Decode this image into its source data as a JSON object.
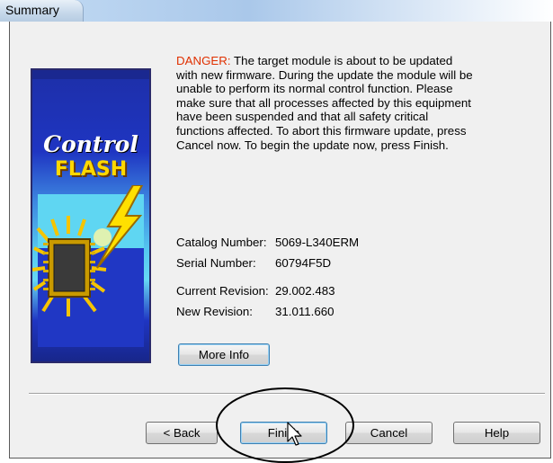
{
  "window": {
    "title": "Summary"
  },
  "banner": {
    "line1": "Control",
    "line2": "FLASH"
  },
  "message": {
    "danger_label": "DANGER:",
    "text": " The target module is about to be updated with new firmware. During the update the module will be unable to perform its normal control function. Please make sure that all processes affected by this equipment have been suspended and that all safety critical functions affected. To abort this firmware update, press Cancel now. To begin the update now, press Finish."
  },
  "details": {
    "catalog_label": "Catalog Number:",
    "catalog_value": "5069-L340ERM",
    "serial_label": "Serial Number:",
    "serial_value": "60794F5D",
    "current_label": "Current Revision:",
    "current_value": "29.002.483",
    "new_label": "New Revision:",
    "new_value": "31.011.660"
  },
  "buttons": {
    "more_info": "More Info",
    "back": "< Back",
    "finish": "Finish",
    "cancel": "Cancel",
    "help": "Help"
  },
  "colors": {
    "danger": "#e03000",
    "banner_blue": "#1f35c2",
    "flash_yellow": "#ffd800",
    "focus_border": "#3c7fb1"
  },
  "icons": {
    "banner_art": "control-flash-chip-lightning-icon",
    "cursor": "mouse-pointer-icon"
  }
}
